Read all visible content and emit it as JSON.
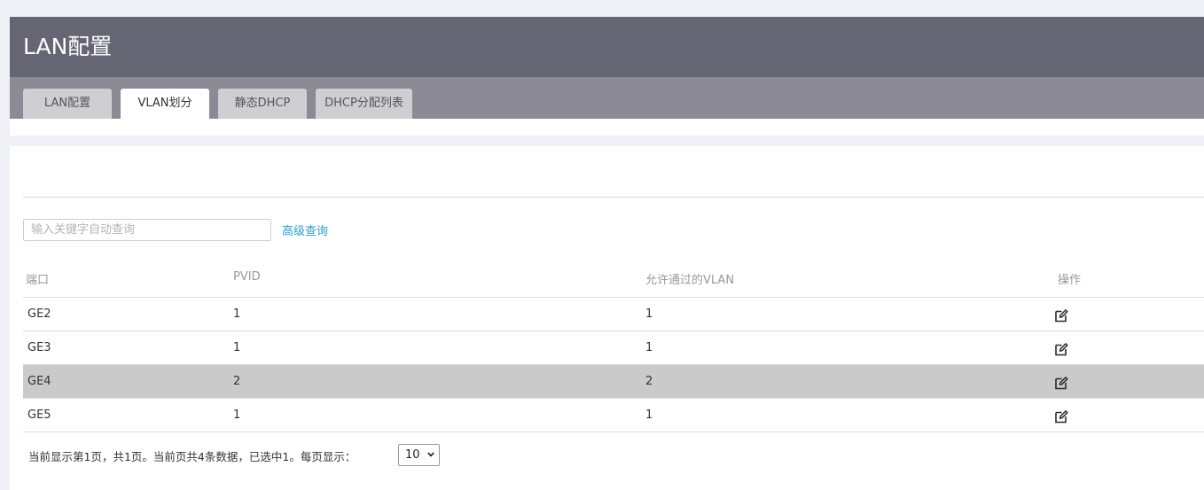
{
  "header": {
    "title": "LAN配置"
  },
  "tabs": [
    {
      "label": "LAN配置",
      "active": false
    },
    {
      "label": "VLAN划分",
      "active": true
    },
    {
      "label": "静态DHCP",
      "active": false
    },
    {
      "label": "DHCP分配列表",
      "active": false
    }
  ],
  "search": {
    "placeholder": "输入关键字自动查询",
    "value": "",
    "advanced_label": "高级查询"
  },
  "table": {
    "columns": [
      "端口",
      "PVID",
      "允许通过的VLAN",
      "操作"
    ],
    "rows": [
      {
        "port": "GE2",
        "pvid": "1",
        "vlan": "1",
        "selected": false
      },
      {
        "port": "GE3",
        "pvid": "1",
        "vlan": "1",
        "selected": false
      },
      {
        "port": "GE4",
        "pvid": "2",
        "vlan": "2",
        "selected": true
      },
      {
        "port": "GE5",
        "pvid": "1",
        "vlan": "1",
        "selected": false
      }
    ]
  },
  "pager": {
    "summary": "当前显示第1页，共1页。当前页共4条数据，已选中1。每页显示：",
    "page_size": "10"
  },
  "colors": {
    "header_bg": "#656673",
    "tab_bar_bg": "#8c8a94",
    "link": "#2a9ed3",
    "selected_row": "#cacaca"
  },
  "icons": {
    "row_action": "edit-icon",
    "select_caret": "chevron-down-icon"
  }
}
